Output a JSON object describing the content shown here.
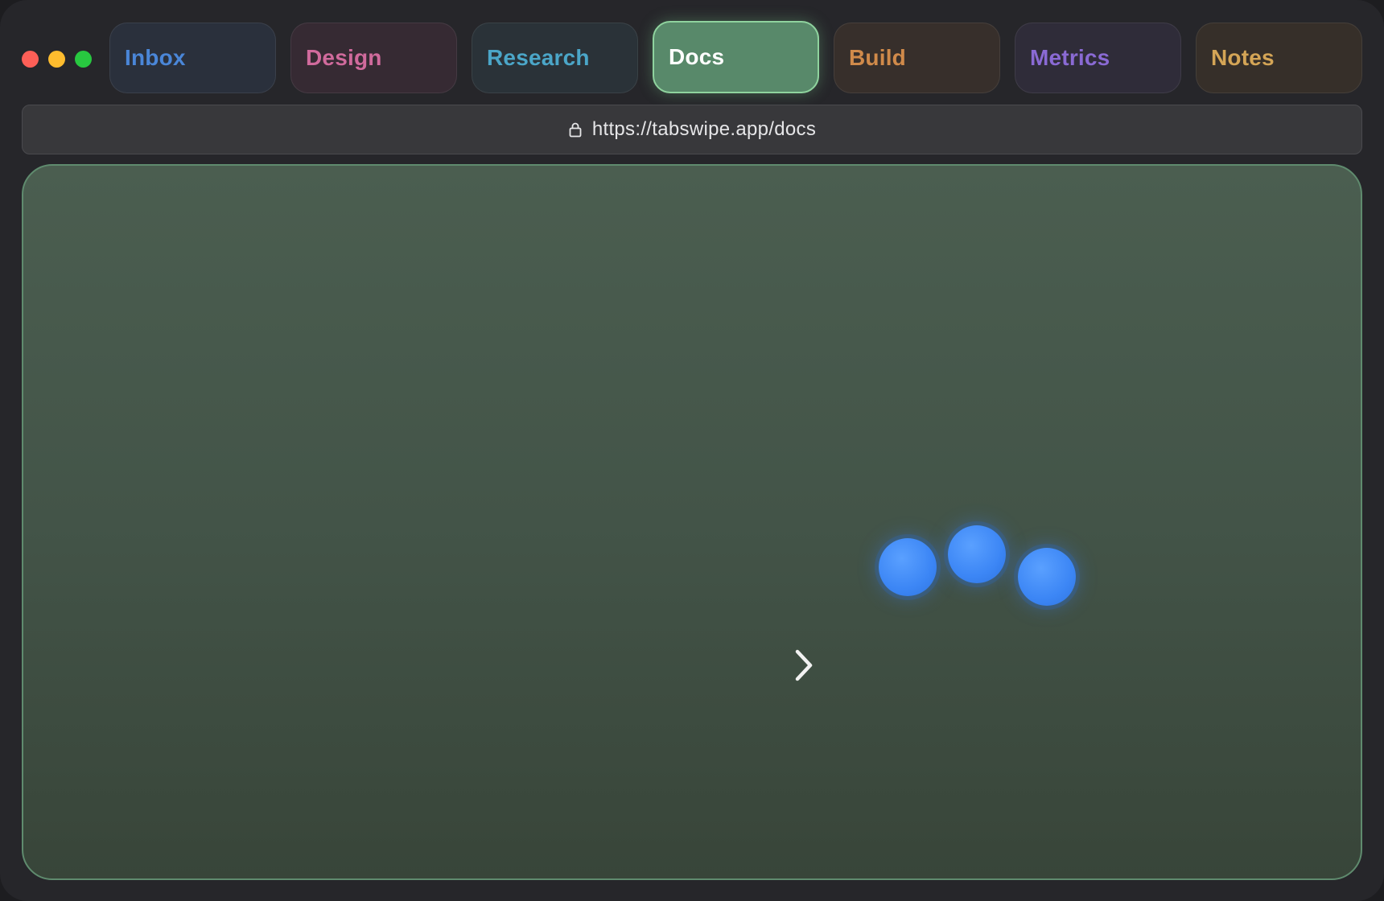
{
  "window": {
    "controls": {
      "close_color": "#fe5f57",
      "minimize_color": "#febc2e",
      "zoom_color": "#28c840"
    }
  },
  "tabs": [
    {
      "label": "Inbox",
      "color": "#4a86d8",
      "bg": "#2a303c",
      "active": false
    },
    {
      "label": "Design",
      "color": "#d06a9c",
      "bg": "#362a33",
      "active": false
    },
    {
      "label": "Research",
      "color": "#4ba6c8",
      "bg": "#2a3238",
      "active": false
    },
    {
      "label": "Docs",
      "color": "#ffffff",
      "bg": "#58896a",
      "active": true
    },
    {
      "label": "Build",
      "color": "#d08a4a",
      "bg": "#372f2b",
      "active": false
    },
    {
      "label": "Metrics",
      "color": "#8a6ad4",
      "bg": "#2f2c39",
      "active": false
    },
    {
      "label": "Notes",
      "color": "#d4a556",
      "bg": "#362f29",
      "active": false
    }
  ],
  "address_bar": {
    "url": "https://tabswipe.app/docs",
    "icon": "lock-icon"
  },
  "content": {
    "accent": "#5f8b6e",
    "icons": [
      "chevron-right-icon"
    ],
    "dots_color": "#3c86f5",
    "dot_count": 3
  }
}
